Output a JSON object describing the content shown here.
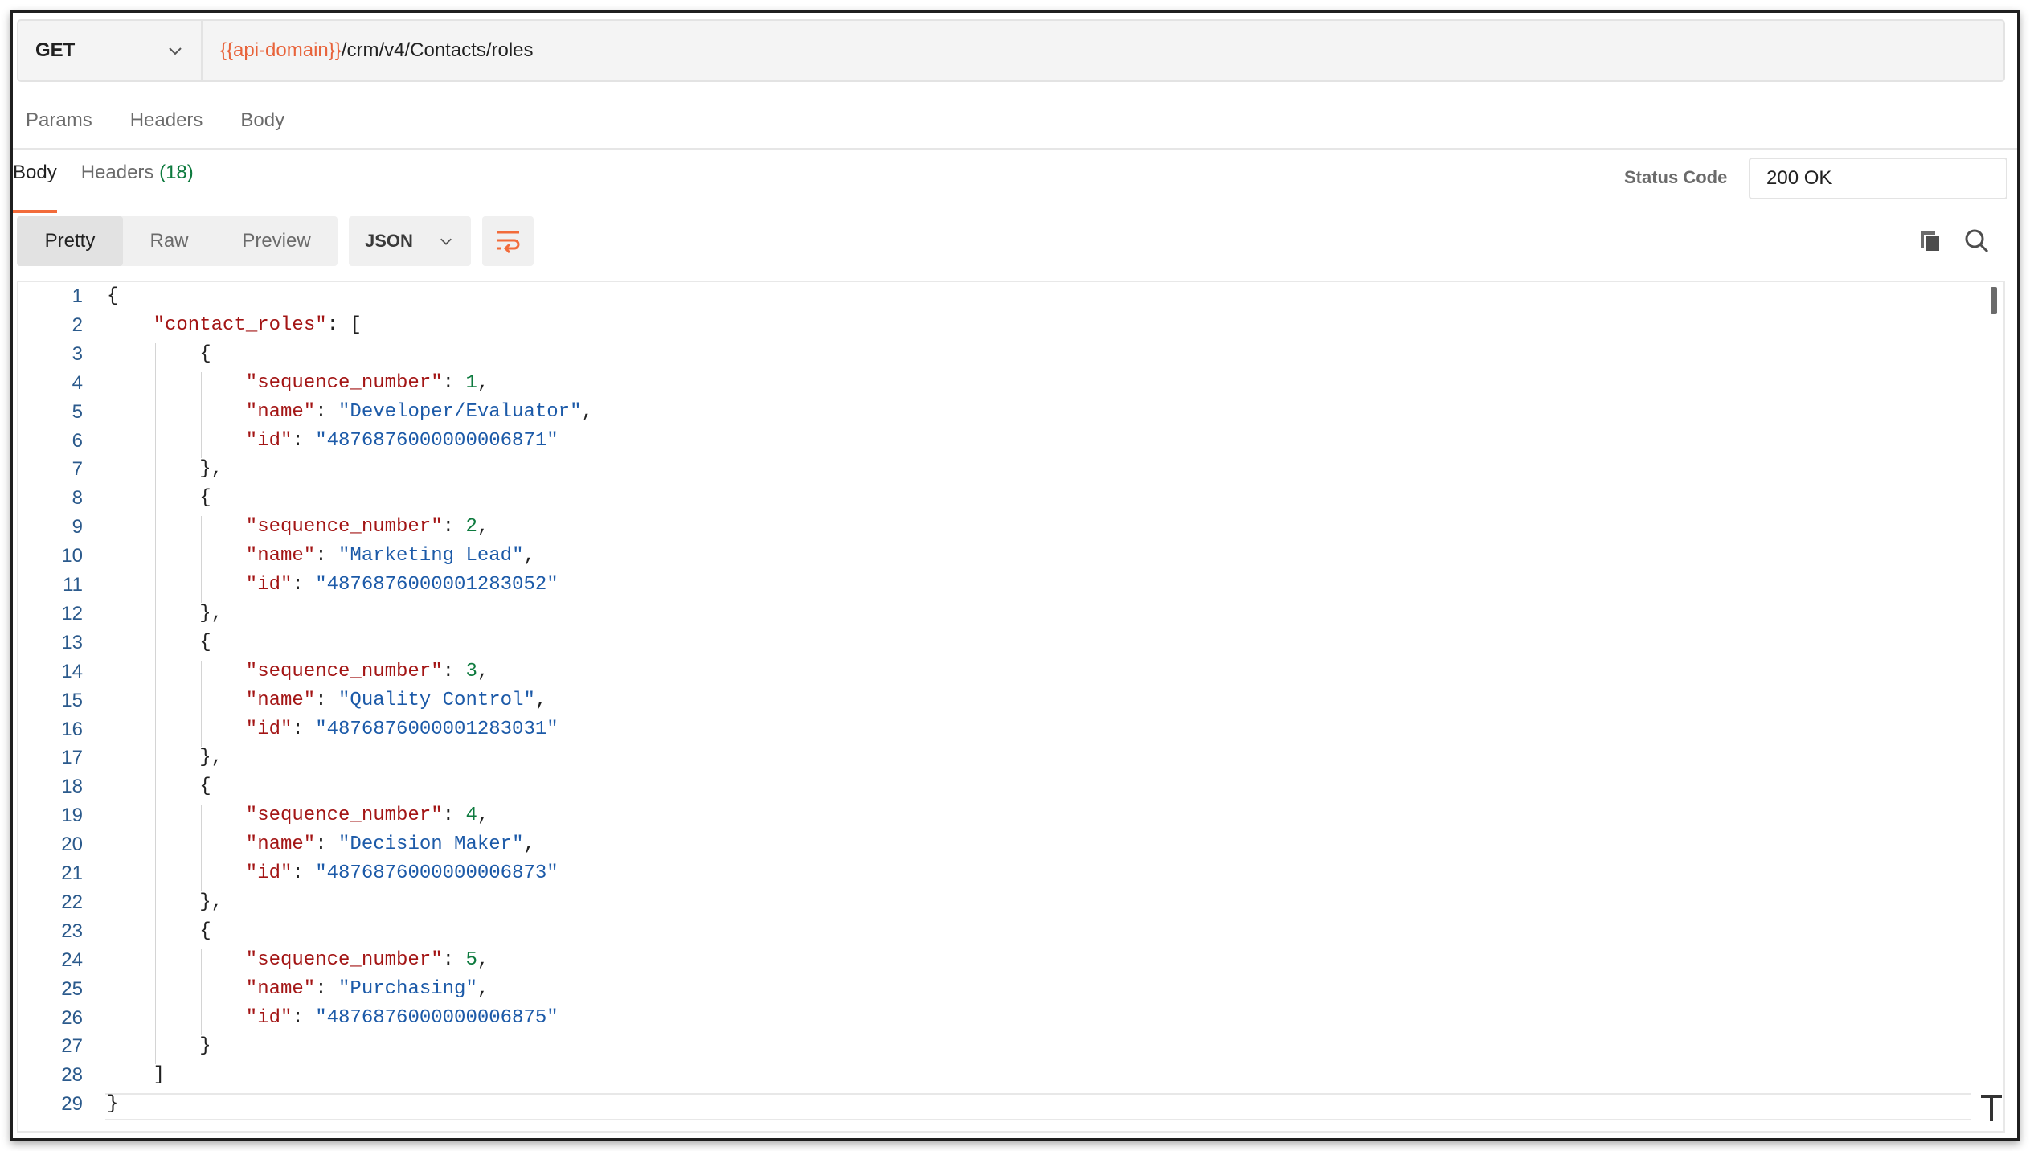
{
  "request": {
    "method": "GET",
    "url_variable": "{{api-domain}}",
    "url_path": "/crm/v4/Contacts/roles"
  },
  "request_tabs": [
    "Params",
    "Headers",
    "Body"
  ],
  "response": {
    "tabs": {
      "body": "Body",
      "headers": "Headers",
      "headers_count": "(18)"
    },
    "status_label": "Status Code",
    "status_value": "200 OK",
    "modes": [
      "Pretty",
      "Raw",
      "Preview"
    ],
    "format": "JSON"
  },
  "icons": {
    "method_dropdown": "chevron-down-icon",
    "format_dropdown": "chevron-down-icon",
    "wrap": "wrap-lines-icon",
    "copy": "copy-icon",
    "search": "search-icon"
  },
  "colors": {
    "accent": "#f26b3a",
    "url_variable": "#e8633a",
    "json_key": "#a31515",
    "json_string": "#1c5aa8",
    "json_number": "#0d7a3e",
    "line_number": "#2b5a8c"
  },
  "code_lines": [
    {
      "n": "1",
      "indent": 0,
      "parts": [
        [
          "p",
          "{"
        ]
      ]
    },
    {
      "n": "2",
      "indent": 1,
      "parts": [
        [
          "k",
          "\"contact_roles\""
        ],
        [
          "p",
          ": ["
        ]
      ]
    },
    {
      "n": "3",
      "indent": 2,
      "parts": [
        [
          "p",
          "{"
        ]
      ]
    },
    {
      "n": "4",
      "indent": 3,
      "parts": [
        [
          "k",
          "\"sequence_number\""
        ],
        [
          "p",
          ": "
        ],
        [
          "n",
          "1"
        ],
        [
          "p",
          ","
        ]
      ]
    },
    {
      "n": "5",
      "indent": 3,
      "parts": [
        [
          "k",
          "\"name\""
        ],
        [
          "p",
          ": "
        ],
        [
          "s",
          "\"Developer/Evaluator\""
        ],
        [
          "p",
          ","
        ]
      ]
    },
    {
      "n": "6",
      "indent": 3,
      "parts": [
        [
          "k",
          "\"id\""
        ],
        [
          "p",
          ": "
        ],
        [
          "s",
          "\"4876876000000006871\""
        ]
      ]
    },
    {
      "n": "7",
      "indent": 2,
      "parts": [
        [
          "p",
          "},"
        ]
      ]
    },
    {
      "n": "8",
      "indent": 2,
      "parts": [
        [
          "p",
          "{"
        ]
      ]
    },
    {
      "n": "9",
      "indent": 3,
      "parts": [
        [
          "k",
          "\"sequence_number\""
        ],
        [
          "p",
          ": "
        ],
        [
          "n",
          "2"
        ],
        [
          "p",
          ","
        ]
      ]
    },
    {
      "n": "10",
      "indent": 3,
      "parts": [
        [
          "k",
          "\"name\""
        ],
        [
          "p",
          ": "
        ],
        [
          "s",
          "\"Marketing Lead\""
        ],
        [
          "p",
          ","
        ]
      ]
    },
    {
      "n": "11",
      "indent": 3,
      "parts": [
        [
          "k",
          "\"id\""
        ],
        [
          "p",
          ": "
        ],
        [
          "s",
          "\"4876876000001283052\""
        ]
      ]
    },
    {
      "n": "12",
      "indent": 2,
      "parts": [
        [
          "p",
          "},"
        ]
      ]
    },
    {
      "n": "13",
      "indent": 2,
      "parts": [
        [
          "p",
          "{"
        ]
      ]
    },
    {
      "n": "14",
      "indent": 3,
      "parts": [
        [
          "k",
          "\"sequence_number\""
        ],
        [
          "p",
          ": "
        ],
        [
          "n",
          "3"
        ],
        [
          "p",
          ","
        ]
      ]
    },
    {
      "n": "15",
      "indent": 3,
      "parts": [
        [
          "k",
          "\"name\""
        ],
        [
          "p",
          ": "
        ],
        [
          "s",
          "\"Quality Control\""
        ],
        [
          "p",
          ","
        ]
      ]
    },
    {
      "n": "16",
      "indent": 3,
      "parts": [
        [
          "k",
          "\"id\""
        ],
        [
          "p",
          ": "
        ],
        [
          "s",
          "\"4876876000001283031\""
        ]
      ]
    },
    {
      "n": "17",
      "indent": 2,
      "parts": [
        [
          "p",
          "},"
        ]
      ]
    },
    {
      "n": "18",
      "indent": 2,
      "parts": [
        [
          "p",
          "{"
        ]
      ]
    },
    {
      "n": "19",
      "indent": 3,
      "parts": [
        [
          "k",
          "\"sequence_number\""
        ],
        [
          "p",
          ": "
        ],
        [
          "n",
          "4"
        ],
        [
          "p",
          ","
        ]
      ]
    },
    {
      "n": "20",
      "indent": 3,
      "parts": [
        [
          "k",
          "\"name\""
        ],
        [
          "p",
          ": "
        ],
        [
          "s",
          "\"Decision Maker\""
        ],
        [
          "p",
          ","
        ]
      ]
    },
    {
      "n": "21",
      "indent": 3,
      "parts": [
        [
          "k",
          "\"id\""
        ],
        [
          "p",
          ": "
        ],
        [
          "s",
          "\"4876876000000006873\""
        ]
      ]
    },
    {
      "n": "22",
      "indent": 2,
      "parts": [
        [
          "p",
          "},"
        ]
      ]
    },
    {
      "n": "23",
      "indent": 2,
      "parts": [
        [
          "p",
          "{"
        ]
      ]
    },
    {
      "n": "24",
      "indent": 3,
      "parts": [
        [
          "k",
          "\"sequence_number\""
        ],
        [
          "p",
          ": "
        ],
        [
          "n",
          "5"
        ],
        [
          "p",
          ","
        ]
      ]
    },
    {
      "n": "25",
      "indent": 3,
      "parts": [
        [
          "k",
          "\"name\""
        ],
        [
          "p",
          ": "
        ],
        [
          "s",
          "\"Purchasing\""
        ],
        [
          "p",
          ","
        ]
      ]
    },
    {
      "n": "26",
      "indent": 3,
      "parts": [
        [
          "k",
          "\"id\""
        ],
        [
          "p",
          ": "
        ],
        [
          "s",
          "\"4876876000000006875\""
        ]
      ]
    },
    {
      "n": "27",
      "indent": 2,
      "parts": [
        [
          "p",
          "}"
        ]
      ]
    },
    {
      "n": "28",
      "indent": 1,
      "parts": [
        [
          "p",
          "]"
        ]
      ]
    },
    {
      "n": "29",
      "indent": 0,
      "parts": [
        [
          "p",
          "}"
        ]
      ]
    }
  ]
}
